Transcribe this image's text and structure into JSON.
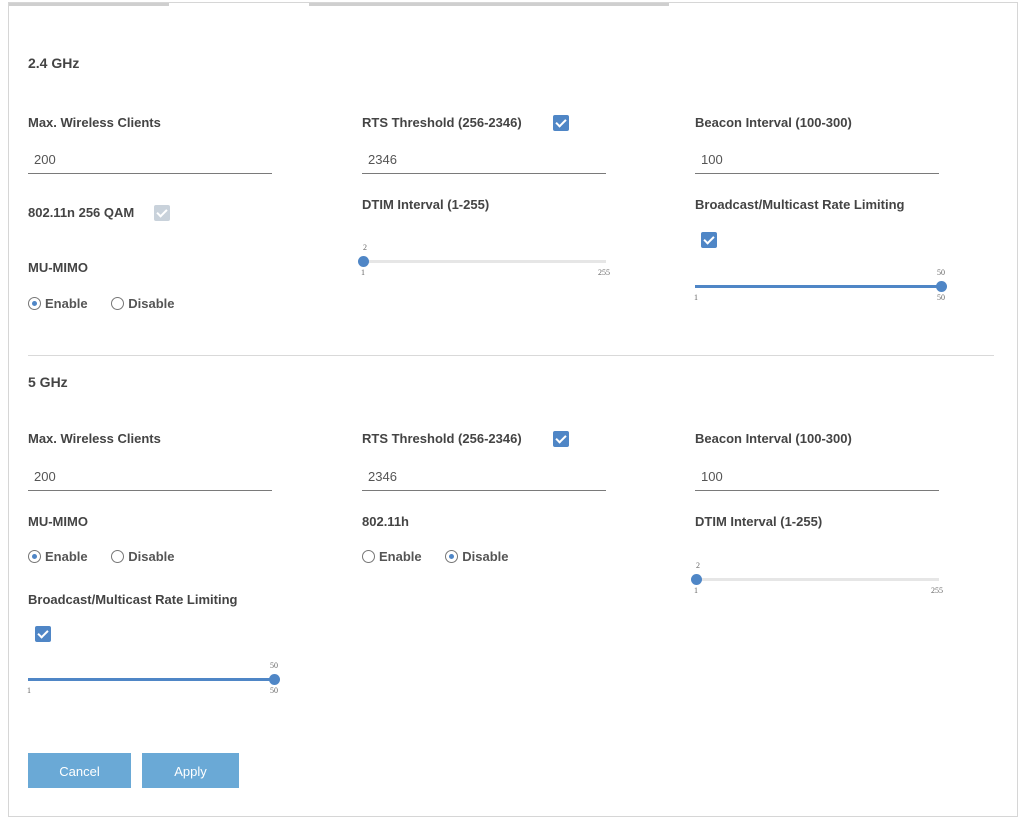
{
  "band24": {
    "title": "2.4 GHz",
    "max_clients": {
      "label": "Max. Wireless Clients",
      "value": "200"
    },
    "rts": {
      "label": "RTS Threshold (256-2346)",
      "value": "2346",
      "checked": true
    },
    "beacon": {
      "label": "Beacon Interval (100-300)",
      "value": "100"
    },
    "qam": {
      "label": "802.11n 256 QAM",
      "checked": true,
      "disabled": true
    },
    "dtim": {
      "label": "DTIM Interval (1-255)",
      "value": "2",
      "min": "1",
      "max": "255",
      "fraction": 0.004
    },
    "rate_limit": {
      "label": "Broadcast/Multicast Rate Limiting",
      "checked": true,
      "value": "50",
      "min": "1",
      "max": "50",
      "fraction": 1.0
    },
    "mumimo": {
      "label": "MU-MIMO",
      "enable": "Enable",
      "disable": "Disable",
      "selected": "Enable"
    }
  },
  "band5": {
    "title": "5 GHz",
    "max_clients": {
      "label": "Max. Wireless Clients",
      "value": "200"
    },
    "rts": {
      "label": "RTS Threshold (256-2346)",
      "value": "2346",
      "checked": true
    },
    "beacon": {
      "label": "Beacon Interval (100-300)",
      "value": "100"
    },
    "mumimo": {
      "label": "MU-MIMO",
      "enable": "Enable",
      "disable": "Disable",
      "selected": "Enable"
    },
    "dot11h": {
      "label": "802.11h",
      "enable": "Enable",
      "disable": "Disable",
      "selected": "Disable"
    },
    "dtim": {
      "label": "DTIM Interval (1-255)",
      "value": "2",
      "min": "1",
      "max": "255",
      "fraction": 0.004
    },
    "rate_limit": {
      "label": "Broadcast/Multicast Rate Limiting",
      "checked": true,
      "value": "50",
      "min": "1",
      "max": "50",
      "fraction": 1.0
    }
  },
  "buttons": {
    "cancel": "Cancel",
    "apply": "Apply"
  },
  "colors": {
    "accent": "#4f86c6",
    "button": "#6aa9d6"
  }
}
